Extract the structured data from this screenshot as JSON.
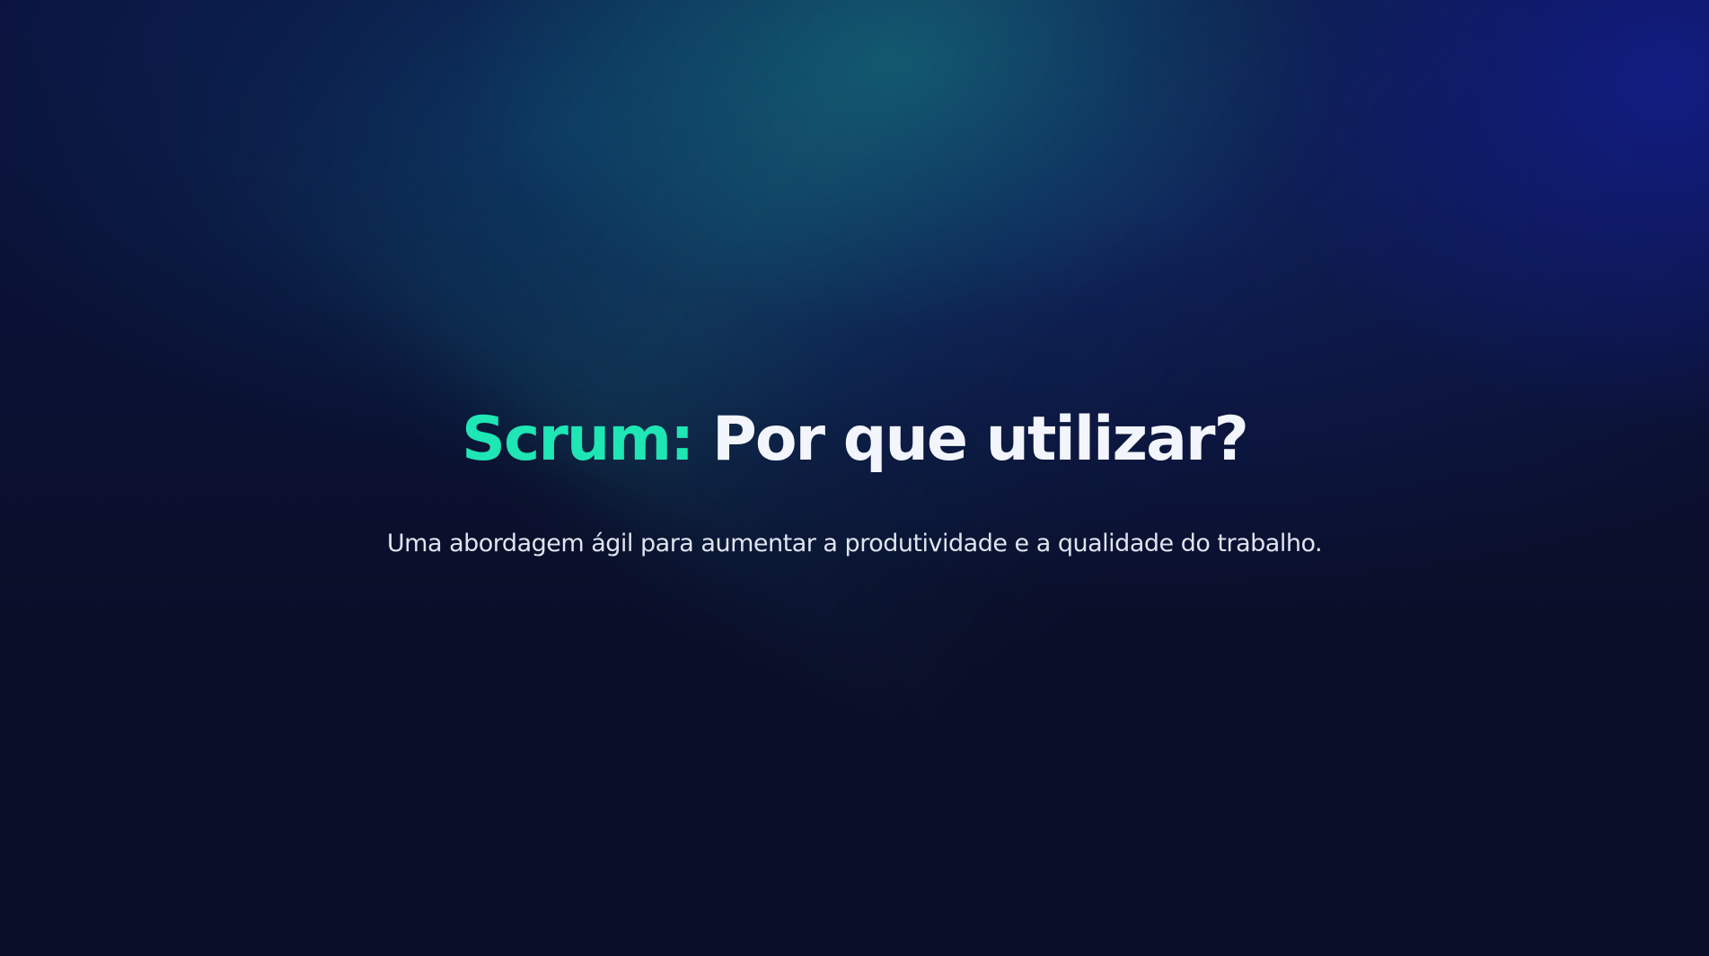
{
  "slide": {
    "title_accent": "Scrum:",
    "title_rest": " Por que utilizar?",
    "subtitle": "Uma abordagem ágil para aumentar a produtividade e a qualidade do trabalho."
  },
  "colors": {
    "background": "#0a0e27",
    "accent": "#1ee6b4",
    "title": "#f2f5fb",
    "subtitle": "#dfe4ef"
  }
}
